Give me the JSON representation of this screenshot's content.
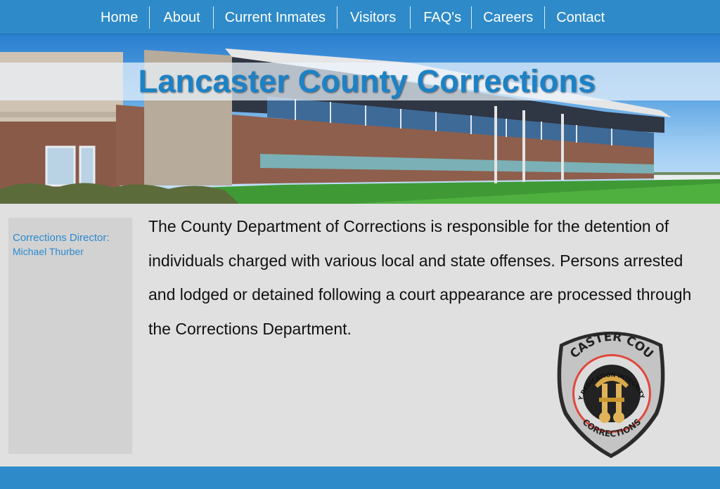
{
  "nav": {
    "items": [
      {
        "label": "Home"
      },
      {
        "label": "About"
      },
      {
        "label": "Current Inmates"
      },
      {
        "label": "Visitors"
      },
      {
        "label": "FAQ's"
      },
      {
        "label": "Careers"
      },
      {
        "label": "Contact"
      }
    ]
  },
  "hero": {
    "title": "Lancaster County Corrections",
    "image": "building-photo"
  },
  "sidebar": {
    "director_label": "Corrections Director:",
    "director_name": "Michael Thurber"
  },
  "main": {
    "intro": "The County Department of Corrections is responsible for the detention of individuals charged with various local and state offenses. Persons arrested and lodged or detained following a court appearance are processed through the Corrections Department."
  },
  "badge": {
    "top_text": "LANCASTER COUNTY",
    "ring_text": "SECURITY DEDICATION INTEGRITY SERVICE",
    "bottom_text": "CORRECTIONS",
    "icon": "corrections-seal"
  },
  "colors": {
    "nav": "#2e8ac8",
    "accent": "#1c82c6",
    "page": "#e0e0e0",
    "sidebar": "#d2d2d2"
  }
}
